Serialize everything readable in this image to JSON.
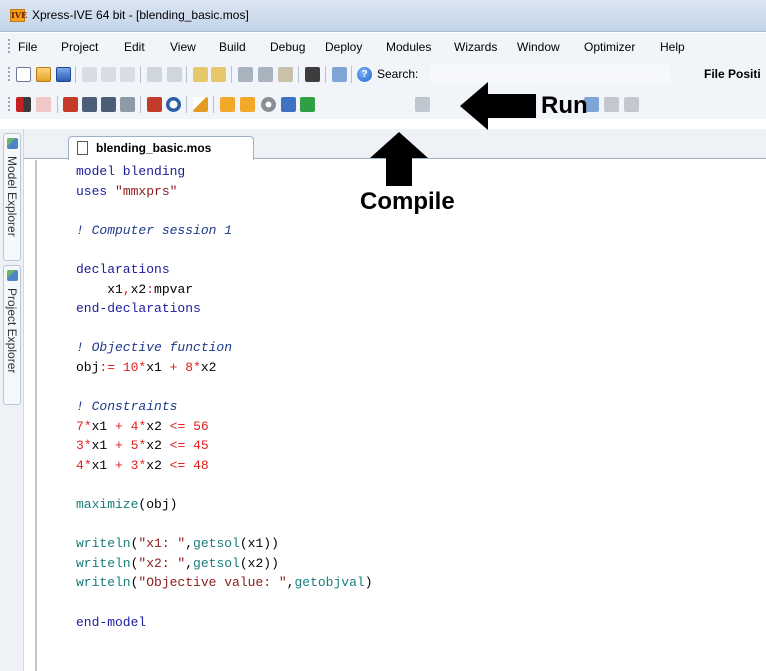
{
  "window": {
    "title": "Xpress-IVE 64 bit - [blending_basic.mos]",
    "logo_text": "IVE"
  },
  "menu": [
    {
      "label": "File"
    },
    {
      "label": "Project"
    },
    {
      "label": "Edit"
    },
    {
      "label": "View"
    },
    {
      "label": "Build"
    },
    {
      "label": "Debug"
    },
    {
      "label": "Deploy"
    },
    {
      "label": "Modules"
    },
    {
      "label": "Wizards"
    },
    {
      "label": "Window"
    },
    {
      "label": "Optimizer"
    },
    {
      "label": "Help"
    }
  ],
  "toolbar": {
    "search_label": "Search:",
    "search_value": "",
    "file_position_label": "File Positi",
    "help_glyph": "?"
  },
  "side_tabs": [
    {
      "label": "Model Explorer"
    },
    {
      "label": "Project Explorer"
    }
  ],
  "editor": {
    "tab_label": "blending_basic.mos"
  },
  "code_lines": [
    {
      "p": [
        [
          "kw",
          "model blending"
        ]
      ]
    },
    {
      "p": [
        [
          "kw",
          "uses "
        ],
        [
          "str",
          "\"mmxprs\""
        ]
      ]
    },
    {
      "p": []
    },
    {
      "p": [
        [
          "cm",
          "! Computer session 1"
        ]
      ]
    },
    {
      "p": []
    },
    {
      "p": [
        [
          "kw",
          "declarations"
        ]
      ]
    },
    {
      "p": [
        [
          "pl",
          "    x1"
        ],
        [
          "op",
          ","
        ],
        [
          "pl",
          "x2"
        ],
        [
          "op",
          ":"
        ],
        [
          "pl",
          "mpvar"
        ]
      ]
    },
    {
      "p": [
        [
          "kw",
          "end-declarations"
        ]
      ]
    },
    {
      "p": []
    },
    {
      "p": [
        [
          "cm",
          "! Objective function"
        ]
      ]
    },
    {
      "p": [
        [
          "pl",
          "obj"
        ],
        [
          "op",
          ":= "
        ],
        [
          "num",
          "10"
        ],
        [
          "op",
          "*"
        ],
        [
          "pl",
          "x1 "
        ],
        [
          "op",
          "+ "
        ],
        [
          "num",
          "8"
        ],
        [
          "op",
          "*"
        ],
        [
          "pl",
          "x2"
        ]
      ]
    },
    {
      "p": []
    },
    {
      "p": [
        [
          "cm",
          "! Constraints"
        ]
      ]
    },
    {
      "p": [
        [
          "num",
          "7"
        ],
        [
          "op",
          "*"
        ],
        [
          "pl",
          "x1 "
        ],
        [
          "op",
          "+ "
        ],
        [
          "num",
          "4"
        ],
        [
          "op",
          "*"
        ],
        [
          "pl",
          "x2 "
        ],
        [
          "op",
          "<= "
        ],
        [
          "num",
          "56"
        ]
      ]
    },
    {
      "p": [
        [
          "num",
          "3"
        ],
        [
          "op",
          "*"
        ],
        [
          "pl",
          "x1 "
        ],
        [
          "op",
          "+ "
        ],
        [
          "num",
          "5"
        ],
        [
          "op",
          "*"
        ],
        [
          "pl",
          "x2 "
        ],
        [
          "op",
          "<= "
        ],
        [
          "num",
          "45"
        ]
      ]
    },
    {
      "p": [
        [
          "num",
          "4"
        ],
        [
          "op",
          "*"
        ],
        [
          "pl",
          "x1 "
        ],
        [
          "op",
          "+ "
        ],
        [
          "num",
          "3"
        ],
        [
          "op",
          "*"
        ],
        [
          "pl",
          "x2 "
        ],
        [
          "op",
          "<= "
        ],
        [
          "num",
          "48"
        ]
      ]
    },
    {
      "p": []
    },
    {
      "p": [
        [
          "fn",
          "maximize"
        ],
        [
          "pl",
          "(obj)"
        ]
      ]
    },
    {
      "p": []
    },
    {
      "p": [
        [
          "fn",
          "writeln"
        ],
        [
          "pl",
          "("
        ],
        [
          "str",
          "\"x1: \""
        ],
        [
          "pl",
          ","
        ],
        [
          "fn",
          "getsol"
        ],
        [
          "pl",
          "(x1))"
        ]
      ]
    },
    {
      "p": [
        [
          "fn",
          "writeln"
        ],
        [
          "pl",
          "("
        ],
        [
          "str",
          "\"x2: \""
        ],
        [
          "pl",
          ","
        ],
        [
          "fn",
          "getsol"
        ],
        [
          "pl",
          "(x2))"
        ]
      ]
    },
    {
      "p": [
        [
          "fn",
          "writeln"
        ],
        [
          "pl",
          "("
        ],
        [
          "str",
          "\"Objective value: \""
        ],
        [
          "pl",
          ","
        ],
        [
          "fn",
          "getobjval"
        ],
        [
          "pl",
          ")"
        ]
      ]
    },
    {
      "p": []
    },
    {
      "p": [
        [
          "kw",
          "end-model"
        ]
      ]
    }
  ],
  "annotations": {
    "compile_label": "Compile",
    "run_label": "Run"
  },
  "colors": {
    "keyword": "#1c1c9c",
    "string": "#8b1a1a",
    "comment": "#1e3a8a",
    "number": "#e02020",
    "function": "#1a7c7c"
  }
}
